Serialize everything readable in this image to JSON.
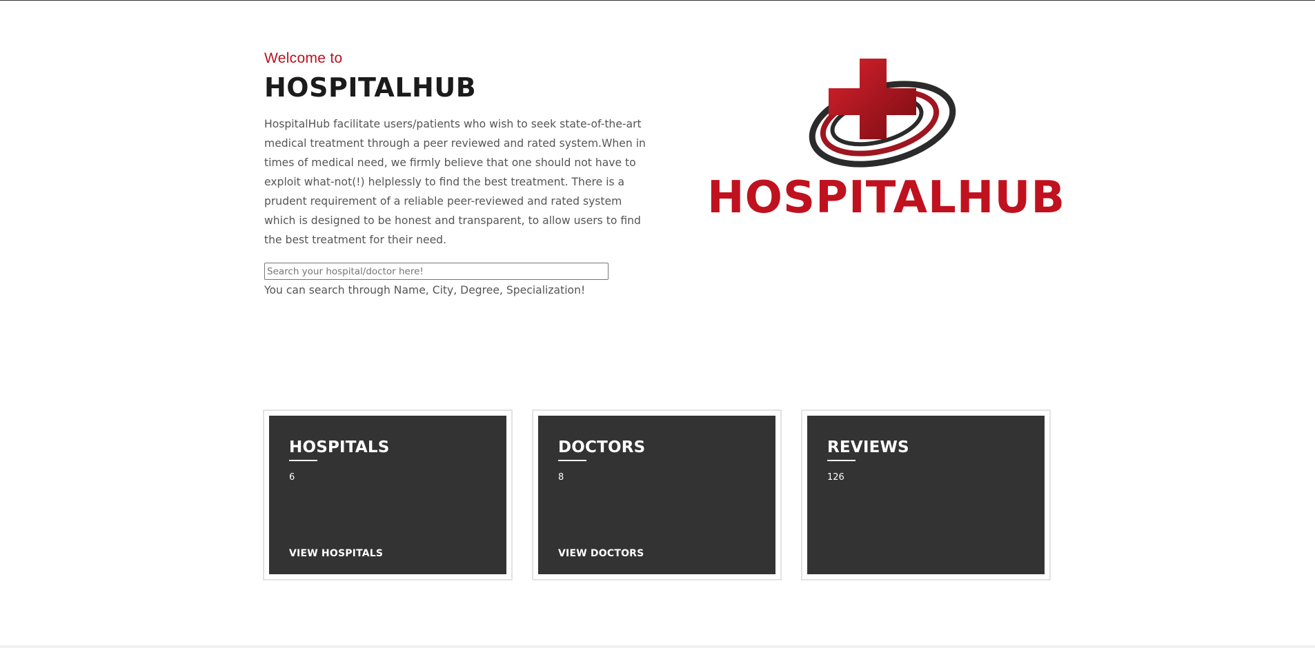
{
  "hero": {
    "welcome": "Welcome to",
    "title": "HOSPITALHUB",
    "description": "HospitalHub facilitate users/patients who wish to seek state-of-the-art medical treatment through a peer reviewed and rated system.When in times of medical need, we firmly believe that one should not have to exploit what-not(!) helplessly to find the best treatment. There is a prudent requirement of a reliable peer-reviewed and rated system which is designed to be honest and transparent, to allow users to find the best treatment for their need."
  },
  "search": {
    "placeholder": "Search your hospital/doctor here!",
    "value": "",
    "hint": "You can search through Name, City, Degree, Specialization!"
  },
  "logo": {
    "text": "HOSPITALHUB",
    "icon": "red-cross-with-rings-icon"
  },
  "colors": {
    "brand_red": "#c0111f",
    "card_bg": "#333333",
    "text_dark": "#1b1b1b",
    "text_body": "#555555"
  },
  "stats": [
    {
      "title": "HOSPITALS",
      "value": "6",
      "link": "VIEW HOSPITALS"
    },
    {
      "title": "DOCTORS",
      "value": "8",
      "link": "VIEW DOCTORS"
    },
    {
      "title": "REVIEWS",
      "value": "126",
      "link": ""
    }
  ]
}
